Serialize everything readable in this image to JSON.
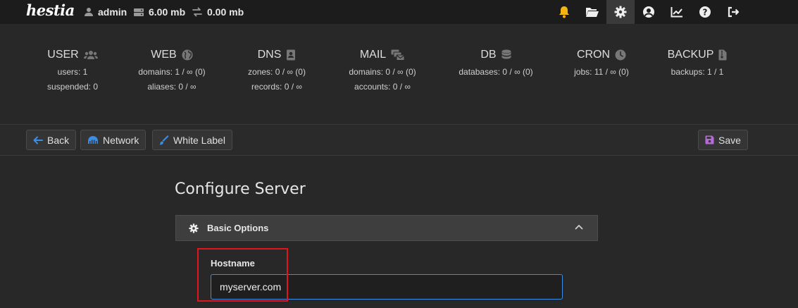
{
  "brand": {
    "logo_text": "hestia"
  },
  "topbar": {
    "user": "admin",
    "disk": "6.00 mb",
    "bandwidth": "0.00 mb",
    "icons": [
      "bell-icon",
      "folder-open-icon",
      "gear-icon",
      "user-circle-icon",
      "chart-line-icon",
      "help-icon",
      "logout-icon"
    ],
    "accent_bell": "#f5b50f"
  },
  "stats": [
    {
      "title": "USER",
      "icon": "users-icon",
      "lines": [
        "users: 1",
        "suspended: 0"
      ]
    },
    {
      "title": "WEB",
      "icon": "globe-icon",
      "lines": [
        "domains: 1 / ∞ (0)",
        "aliases: 0 / ∞"
      ]
    },
    {
      "title": "DNS",
      "icon": "address-book-icon",
      "lines": [
        "zones: 0 / ∞ (0)",
        "records: 0 / ∞"
      ]
    },
    {
      "title": "MAIL",
      "icon": "mail-bulk-icon",
      "lines": [
        "domains: 0 / ∞ (0)",
        "accounts: 0 / ∞"
      ]
    },
    {
      "title": "DB",
      "icon": "database-icon",
      "lines": [
        "databases: 0 / ∞ (0)"
      ]
    },
    {
      "title": "CRON",
      "icon": "clock-icon",
      "lines": [
        "jobs: 11 / ∞ (0)"
      ]
    },
    {
      "title": "BACKUP",
      "icon": "file-archive-icon",
      "lines": [
        "backups: 1 / 1"
      ]
    }
  ],
  "toolbar": {
    "back_label": "Back",
    "network_label": "Network",
    "whitelabel_label": "White Label",
    "save_label": "Save",
    "accent_blue": "#3a8ee6",
    "accent_purple": "#b56ad8"
  },
  "page": {
    "title": "Configure Server",
    "section_label": "Basic Options",
    "hostname_label": "Hostname",
    "hostname_value": "myserver.com"
  }
}
